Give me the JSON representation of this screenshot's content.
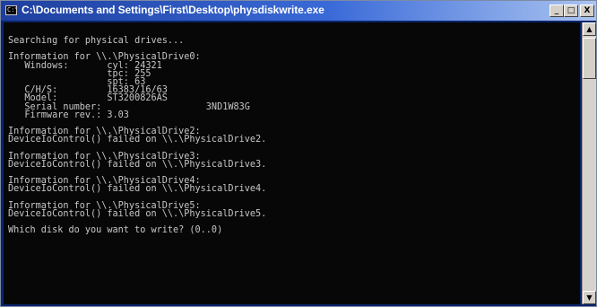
{
  "window": {
    "title": "C:\\Documents and Settings\\First\\Desktop\\physdiskwrite.exe",
    "icon": "console-icon",
    "controls": {
      "minimize": "_",
      "maximize": "□",
      "close": "X"
    }
  },
  "console": {
    "lines": [
      "Searching for physical drives...",
      "",
      "Information for \\\\.\\PhysicalDrive0:",
      "   Windows:       cyl: 24321",
      "                  tpc: 255",
      "                  spt: 63",
      "   C/H/S:         16383/16/63",
      "   Model:         ST3200826AS",
      "   Serial number:                   3ND1W83G",
      "   Firmware rev.: 3.03",
      "",
      "Information for \\\\.\\PhysicalDrive2:",
      "DeviceIoControl() failed on \\\\.\\PhysicalDrive2.",
      "",
      "Information for \\\\.\\PhysicalDrive3:",
      "DeviceIoControl() failed on \\\\.\\PhysicalDrive3.",
      "",
      "Information for \\\\.\\PhysicalDrive4:",
      "DeviceIoControl() failed on \\\\.\\PhysicalDrive4.",
      "",
      "Information for \\\\.\\PhysicalDrive5:",
      "DeviceIoControl() failed on \\\\.\\PhysicalDrive5.",
      "",
      "Which disk do you want to write? (0..0)"
    ]
  },
  "scrollbar": {
    "up_arrow": "▲",
    "down_arrow": "▼"
  }
}
